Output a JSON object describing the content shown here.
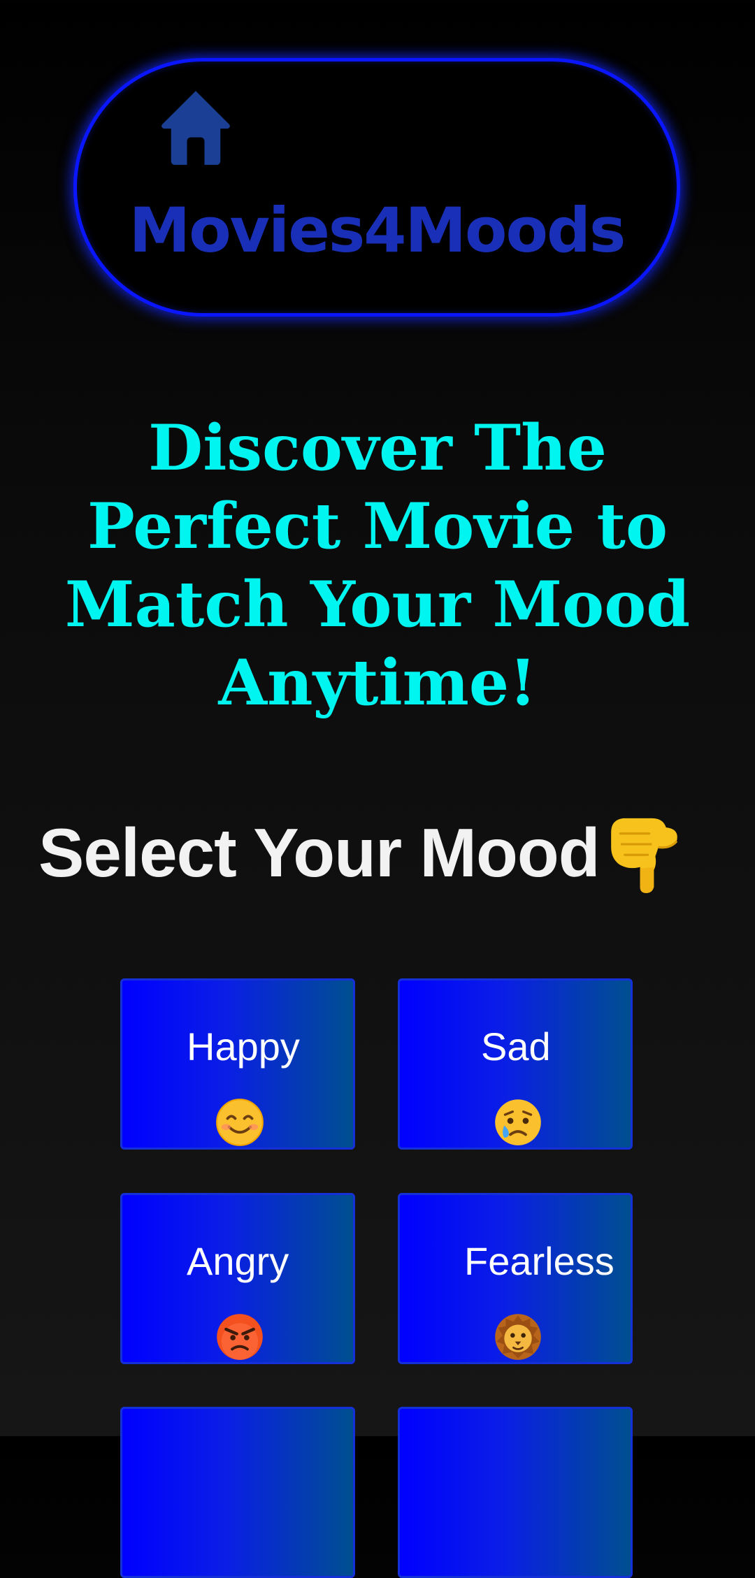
{
  "header": {
    "home_icon": "home-icon",
    "title": "Movies4Moods"
  },
  "hero": {
    "tagline": "Discover The Perfect Movie to Match Your Mood Anytime!"
  },
  "select": {
    "title": "Select Your Mood",
    "icon": "pointing-down-icon"
  },
  "moods": [
    {
      "label": "Happy",
      "icon": "smiling-face-icon"
    },
    {
      "label": "Sad",
      "icon": "crying-face-icon"
    },
    {
      "label": "Angry",
      "icon": "angry-face-icon"
    },
    {
      "label": "Fearless",
      "icon": "lion-face-icon"
    }
  ],
  "colors": {
    "accent_blue": "#0a16ff",
    "title_blue": "#1a2fb8",
    "tagline_cyan": "#00f5f0",
    "card_start": "#0000ff",
    "card_end": "#004f90"
  }
}
